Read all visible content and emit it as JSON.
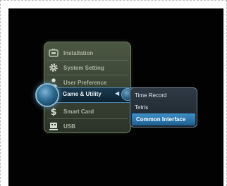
{
  "menu": {
    "items": [
      {
        "label": "Installation",
        "icon": "tv-icon"
      },
      {
        "label": "System Setting",
        "icon": "gear-icon"
      },
      {
        "label": "User Preference",
        "icon": "user-icon"
      },
      {
        "label": "Game & Utility",
        "icon": "globe-icon",
        "selected": true
      },
      {
        "label": "Smart Card",
        "icon": "dollar-icon"
      },
      {
        "label": "USB",
        "icon": "usb-icon"
      }
    ]
  },
  "submenu": {
    "items": [
      {
        "label": "Time Record"
      },
      {
        "label": "Tetris"
      },
      {
        "label": "Common Interface",
        "selected": true
      }
    ]
  },
  "colors": {
    "panel": "#3b4636",
    "selected": "#1c5f93",
    "text": "#a9b3a1"
  }
}
